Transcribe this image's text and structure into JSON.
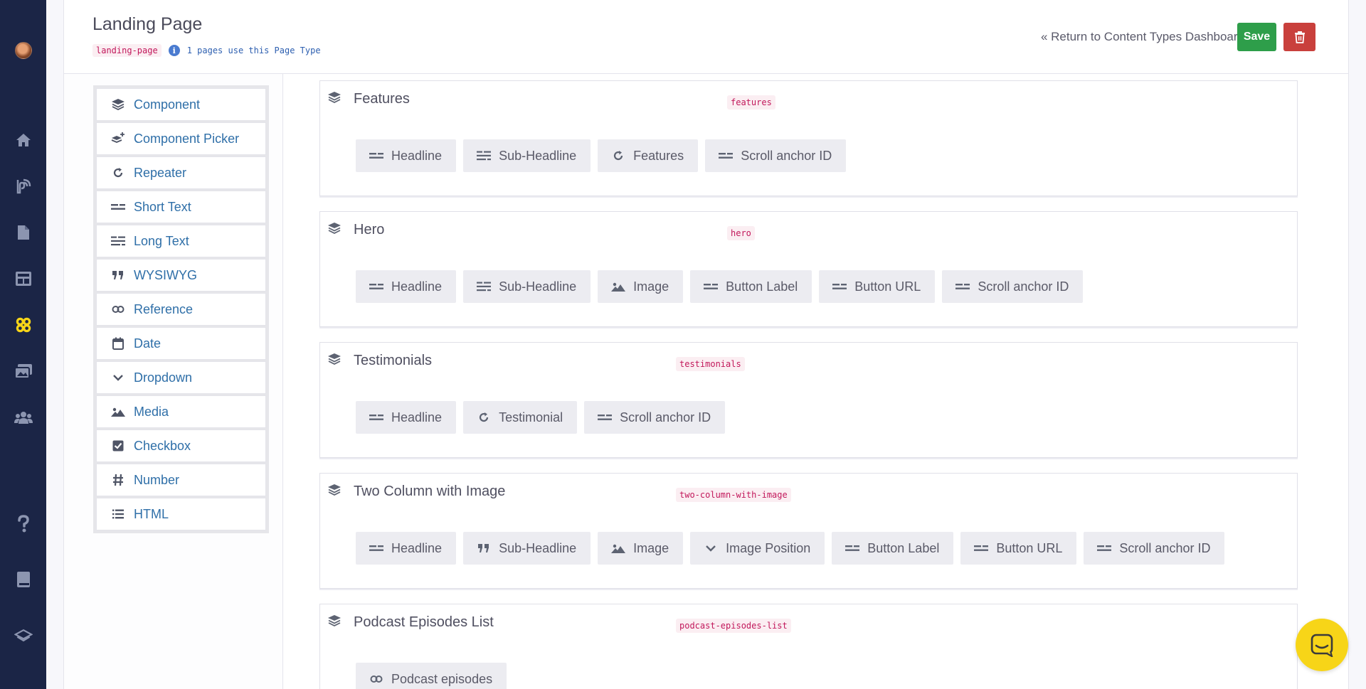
{
  "header": {
    "title": "Landing Page",
    "slug": "landing-page",
    "usage": "1 pages use this Page Type",
    "return_link": "« Return to Content Types Dashboard",
    "save_label": "Save"
  },
  "nav": {
    "items": [
      "home-icon",
      "blog-icon",
      "pages-icon",
      "layout-icon",
      "components-icon",
      "media-icon",
      "users-icon",
      "help-icon",
      "docs-icon",
      "stack-icon"
    ],
    "active": "components-icon"
  },
  "field_types": [
    {
      "label": "Component",
      "icon": "layers-icon"
    },
    {
      "label": "Component Picker",
      "icon": "layers-plus-icon"
    },
    {
      "label": "Repeater",
      "icon": "repeat-icon"
    },
    {
      "label": "Short Text",
      "icon": "short-text-icon"
    },
    {
      "label": "Long Text",
      "icon": "long-text-icon"
    },
    {
      "label": "WYSIWYG",
      "icon": "quote-icon"
    },
    {
      "label": "Reference",
      "icon": "link-icon"
    },
    {
      "label": "Date",
      "icon": "calendar-icon"
    },
    {
      "label": "Dropdown",
      "icon": "chevron-down-icon"
    },
    {
      "label": "Media",
      "icon": "image-icon"
    },
    {
      "label": "Checkbox",
      "icon": "checkbox-icon"
    },
    {
      "label": "Number",
      "icon": "hash-icon"
    },
    {
      "label": "HTML",
      "icon": "list-icon"
    }
  ],
  "components": [
    {
      "title": "Features",
      "slug": "features",
      "fields": [
        {
          "label": "Headline",
          "icon": "short-text-icon"
        },
        {
          "label": "Sub-Headline",
          "icon": "long-text-icon"
        },
        {
          "label": "Features",
          "icon": "repeat-icon"
        },
        {
          "label": "Scroll anchor ID",
          "icon": "short-text-icon"
        }
      ]
    },
    {
      "title": "Hero",
      "slug": "hero",
      "fields": [
        {
          "label": "Headline",
          "icon": "short-text-icon"
        },
        {
          "label": "Sub-Headline",
          "icon": "long-text-icon"
        },
        {
          "label": "Image",
          "icon": "image-icon"
        },
        {
          "label": "Button Label",
          "icon": "short-text-icon"
        },
        {
          "label": "Button URL",
          "icon": "short-text-icon"
        },
        {
          "label": "Scroll anchor ID",
          "icon": "short-text-icon"
        }
      ]
    },
    {
      "title": "Testimonials",
      "slug": "testimonials",
      "fields": [
        {
          "label": "Headline",
          "icon": "short-text-icon"
        },
        {
          "label": "Testimonial",
          "icon": "repeat-icon"
        },
        {
          "label": "Scroll anchor ID",
          "icon": "short-text-icon"
        }
      ]
    },
    {
      "title": "Two Column with Image",
      "slug": "two-column-with-image",
      "fields": [
        {
          "label": "Headline",
          "icon": "short-text-icon"
        },
        {
          "label": "Sub-Headline",
          "icon": "quote-icon"
        },
        {
          "label": "Image",
          "icon": "image-icon"
        },
        {
          "label": "Image Position",
          "icon": "chevron-down-icon"
        },
        {
          "label": "Button Label",
          "icon": "short-text-icon"
        },
        {
          "label": "Button URL",
          "icon": "short-text-icon"
        },
        {
          "label": "Scroll anchor ID",
          "icon": "short-text-icon"
        }
      ]
    },
    {
      "title": "Podcast Episodes List",
      "slug": "podcast-episodes-list",
      "fields": [
        {
          "label": "Podcast episodes",
          "icon": "link-icon"
        }
      ]
    }
  ],
  "colors": {
    "nav_bg": "#1b2546",
    "accent_link": "#2f6fa8",
    "save": "#2e9e4a",
    "delete": "#c9403c",
    "slug": "#c2185b",
    "chat": "#f7d518"
  }
}
